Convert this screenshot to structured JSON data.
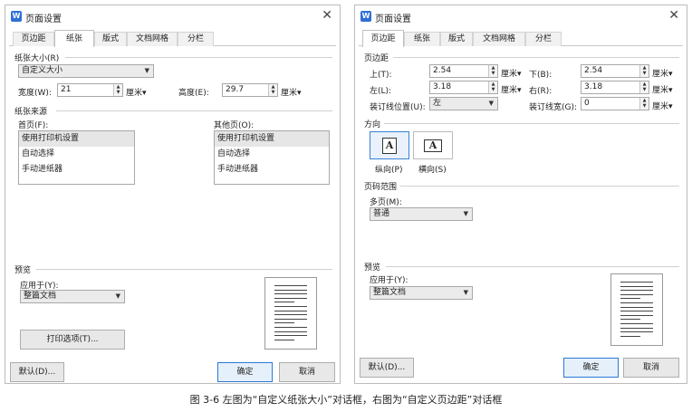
{
  "left": {
    "title": "页面设置",
    "tabs": [
      "页边距",
      "纸张",
      "版式",
      "文档网格",
      "分栏"
    ],
    "paper_size": {
      "section": "纸张大小(R)",
      "selected": "自定义大小",
      "width_label": "宽度(W):",
      "width_value": "21",
      "height_label": "高度(E):",
      "height_value": "29.7",
      "unit": "厘米"
    },
    "paper_source": {
      "section": "纸张来源",
      "first_label": "首页(F):",
      "other_label": "其他页(O):",
      "first_items": [
        "使用打印机设置",
        "自动选择",
        "手动进纸器"
      ],
      "other_items": [
        "使用打印机设置",
        "自动选择",
        "手动进纸器"
      ]
    },
    "preview": {
      "section": "预览",
      "apply_label": "应用于(Y):",
      "apply_value": "整篇文档"
    },
    "print_options": "打印选项(T)...",
    "default_button": "默认(D)...",
    "ok_button": "确定",
    "cancel_button": "取消"
  },
  "right": {
    "title": "页面设置",
    "tabs": [
      "页边距",
      "纸张",
      "版式",
      "文档网格",
      "分栏"
    ],
    "margins": {
      "section": "页边距",
      "top_label": "上(T):",
      "top_value": "2.54",
      "bottom_label": "下(B):",
      "bottom_value": "2.54",
      "left_label": "左(L):",
      "left_value": "3.18",
      "right_label": "右(R):",
      "right_value": "3.18",
      "gutter_pos_label": "装订线位置(U):",
      "gutter_pos_value": "左",
      "gutter_width_label": "装订线宽(G):",
      "gutter_width_value": "0",
      "unit": "厘米"
    },
    "orientation": {
      "section": "方向",
      "portrait": "纵向(P)",
      "landscape": "横向(S)"
    },
    "pages": {
      "section": "页码范围",
      "multi_label": "多页(M):",
      "multi_value": "普通"
    },
    "preview": {
      "section": "预览",
      "apply_label": "应用于(Y):",
      "apply_value": "整篇文档"
    },
    "default_button": "默认(D)...",
    "ok_button": "确定",
    "cancel_button": "取消"
  },
  "caption": "图 3-6 左图为“自定义纸张大小”对话框，右图为“自定义页边距”对话框"
}
